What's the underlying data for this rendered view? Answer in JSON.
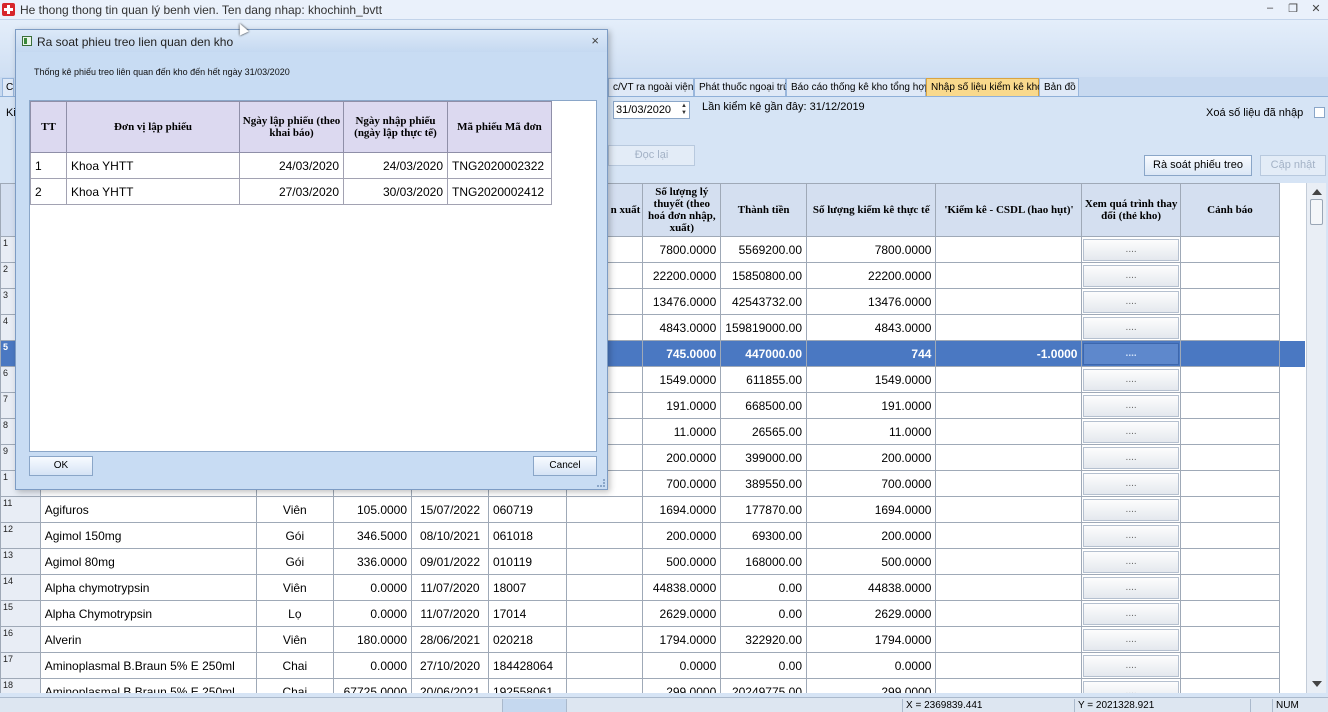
{
  "window": {
    "title": "He thong thong tin quan lý benh vien. Ten dang nhap: khochinh_bvtt",
    "minimize": "–",
    "restore": "❐",
    "close": "✕"
  },
  "tabs": [
    {
      "label": "c/VT ra ngoài viện",
      "active": false
    },
    {
      "label": "Phát thuốc ngoại trú",
      "active": false
    },
    {
      "label": "Báo cáo thống kê kho tổng hợp",
      "active": false
    },
    {
      "label": "Nhập số liệu kiểm kê kho",
      "active": true
    },
    {
      "label": "Bản đồ",
      "active": false
    }
  ],
  "tab_left_fragment": "C",
  "toolbar": {
    "left_fragment": "Ki",
    "date_value": "31/03/2020",
    "last_inventory": "Lần kiểm kê gần đây: 31/12/2019",
    "clear_entered": "Xoá số liệu đã nhập",
    "reload_button": "Đọc lại",
    "review_button": "Rà soát phiếu treo",
    "update_button": "Cập nhật"
  },
  "grid": {
    "headers": {
      "export": "n xuất",
      "theoretical": "Số lượng lý thuyết (theo hoá đơn nhập, xuất)",
      "amount": "Thành tiền",
      "actual": "Số lượng kiểm kê thực tế",
      "diff": "'Kiểm kê - CSDL (hao hụt)'",
      "history": "Xem quá trình thay đổi (thẻ kho)",
      "warning": "Cảnh báo"
    },
    "history_button": "....",
    "rows": [
      {
        "n": "1",
        "name": "",
        "unit": "",
        "price": "",
        "expiry": "",
        "lot": "",
        "theo": "7800.0000",
        "amount": "5569200.00",
        "actual": "7800.0000",
        "diff": ""
      },
      {
        "n": "2",
        "name": "",
        "unit": "",
        "price": "",
        "expiry": "",
        "lot": "",
        "theo": "22200.0000",
        "amount": "15850800.00",
        "actual": "22200.0000",
        "diff": ""
      },
      {
        "n": "3",
        "name": "",
        "unit": "",
        "price": "",
        "expiry": "",
        "lot": "",
        "theo": "13476.0000",
        "amount": "42543732.00",
        "actual": "13476.0000",
        "diff": ""
      },
      {
        "n": "4",
        "name": "",
        "unit": "",
        "price": "",
        "expiry": "",
        "lot": "",
        "theo": "4843.0000",
        "amount": "159819000.00",
        "actual": "4843.0000",
        "diff": ""
      },
      {
        "n": "5",
        "name": "",
        "unit": "",
        "price": "",
        "expiry": "",
        "lot": "",
        "theo": "745.0000",
        "amount": "447000.00",
        "actual": "744",
        "diff": "-1.0000"
      },
      {
        "n": "6",
        "name": "",
        "unit": "",
        "price": "",
        "expiry": "",
        "lot": "",
        "theo": "1549.0000",
        "amount": "611855.00",
        "actual": "1549.0000",
        "diff": ""
      },
      {
        "n": "7",
        "name": "",
        "unit": "",
        "price": "",
        "expiry": "",
        "lot": "",
        "theo": "191.0000",
        "amount": "668500.00",
        "actual": "191.0000",
        "diff": ""
      },
      {
        "n": "8",
        "name": "",
        "unit": "",
        "price": "",
        "expiry": "",
        "lot": "",
        "theo": "11.0000",
        "amount": "26565.00",
        "actual": "11.0000",
        "diff": ""
      },
      {
        "n": "9",
        "name": "",
        "unit": "",
        "price": "",
        "expiry": "",
        "lot": "",
        "theo": "200.0000",
        "amount": "399000.00",
        "actual": "200.0000",
        "diff": ""
      },
      {
        "n": "1",
        "name": "",
        "unit": "",
        "price": "",
        "expiry": "",
        "lot": "",
        "theo": "700.0000",
        "amount": "389550.00",
        "actual": "700.0000",
        "diff": ""
      },
      {
        "n": "11",
        "name": "Agifuros",
        "unit": "Viên",
        "price": "105.0000",
        "expiry": "15/07/2022",
        "lot": "060719",
        "theo": "1694.0000",
        "amount": "177870.00",
        "actual": "1694.0000",
        "diff": ""
      },
      {
        "n": "12",
        "name": "Agimol 150mg",
        "unit": "Gói",
        "price": "346.5000",
        "expiry": "08/10/2021",
        "lot": "061018",
        "theo": "200.0000",
        "amount": "69300.00",
        "actual": "200.0000",
        "diff": ""
      },
      {
        "n": "13",
        "name": "Agimol 80mg",
        "unit": "Gói",
        "price": "336.0000",
        "expiry": "09/01/2022",
        "lot": "010119",
        "theo": "500.0000",
        "amount": "168000.00",
        "actual": "500.0000",
        "diff": ""
      },
      {
        "n": "14",
        "name": "Alpha chymotrypsin",
        "unit": "Viên",
        "price": "0.0000",
        "expiry": "11/07/2020",
        "lot": "18007",
        "theo": "44838.0000",
        "amount": "0.00",
        "actual": "44838.0000",
        "diff": ""
      },
      {
        "n": "15",
        "name": "Alpha Chymotrypsin",
        "unit": "Lọ",
        "price": "0.0000",
        "expiry": "11/07/2020",
        "lot": "17014",
        "theo": "2629.0000",
        "amount": "0.00",
        "actual": "2629.0000",
        "diff": ""
      },
      {
        "n": "16",
        "name": "Alverin",
        "unit": "Viên",
        "price": "180.0000",
        "expiry": "28/06/2021",
        "lot": "020218",
        "theo": "1794.0000",
        "amount": "322920.00",
        "actual": "1794.0000",
        "diff": ""
      },
      {
        "n": "17",
        "name": "Aminoplasmal B.Braun 5% E 250ml",
        "unit": "Chai",
        "price": "0.0000",
        "expiry": "27/10/2020",
        "lot": "184428064",
        "theo": "0.0000",
        "amount": "0.00",
        "actual": "0.0000",
        "diff": ""
      },
      {
        "n": "18",
        "name": "Aminoplasmal B.Braun 5% E 250ml",
        "unit": "Chai",
        "price": "67725.0000",
        "expiry": "20/06/2021",
        "lot": "192558061",
        "theo": "299.0000",
        "amount": "20249775.00",
        "actual": "299.0000",
        "diff": ""
      }
    ]
  },
  "dialog": {
    "title": "Ra soat phieu treo lien quan den kho",
    "close": "×",
    "subtitle": "Thống kê phiếu treo liên quan đến kho đến hết ngày 31/03/2020",
    "headers": {
      "tt": "TT",
      "unit": "Đơn vị lập phiếu",
      "created": "Ngày lập phiếu (theo khai báo)",
      "entered": "Ngày nhập phiếu (ngày lập thực tế)",
      "code": "Mã phiếu Mã đơn"
    },
    "rows": [
      {
        "tt": "1",
        "unit": "Khoa YHTT",
        "created": "24/03/2020",
        "entered": "24/03/2020",
        "code": "TNG2020002322"
      },
      {
        "tt": "2",
        "unit": "Khoa YHTT",
        "created": "27/03/2020",
        "entered": "30/03/2020",
        "code": "TNG2020002412"
      }
    ],
    "ok": "OK",
    "cancel": "Cancel"
  },
  "status": {
    "x": "X = 2369839.441",
    "y": "Y = 2021328.921",
    "num": "NUM"
  }
}
